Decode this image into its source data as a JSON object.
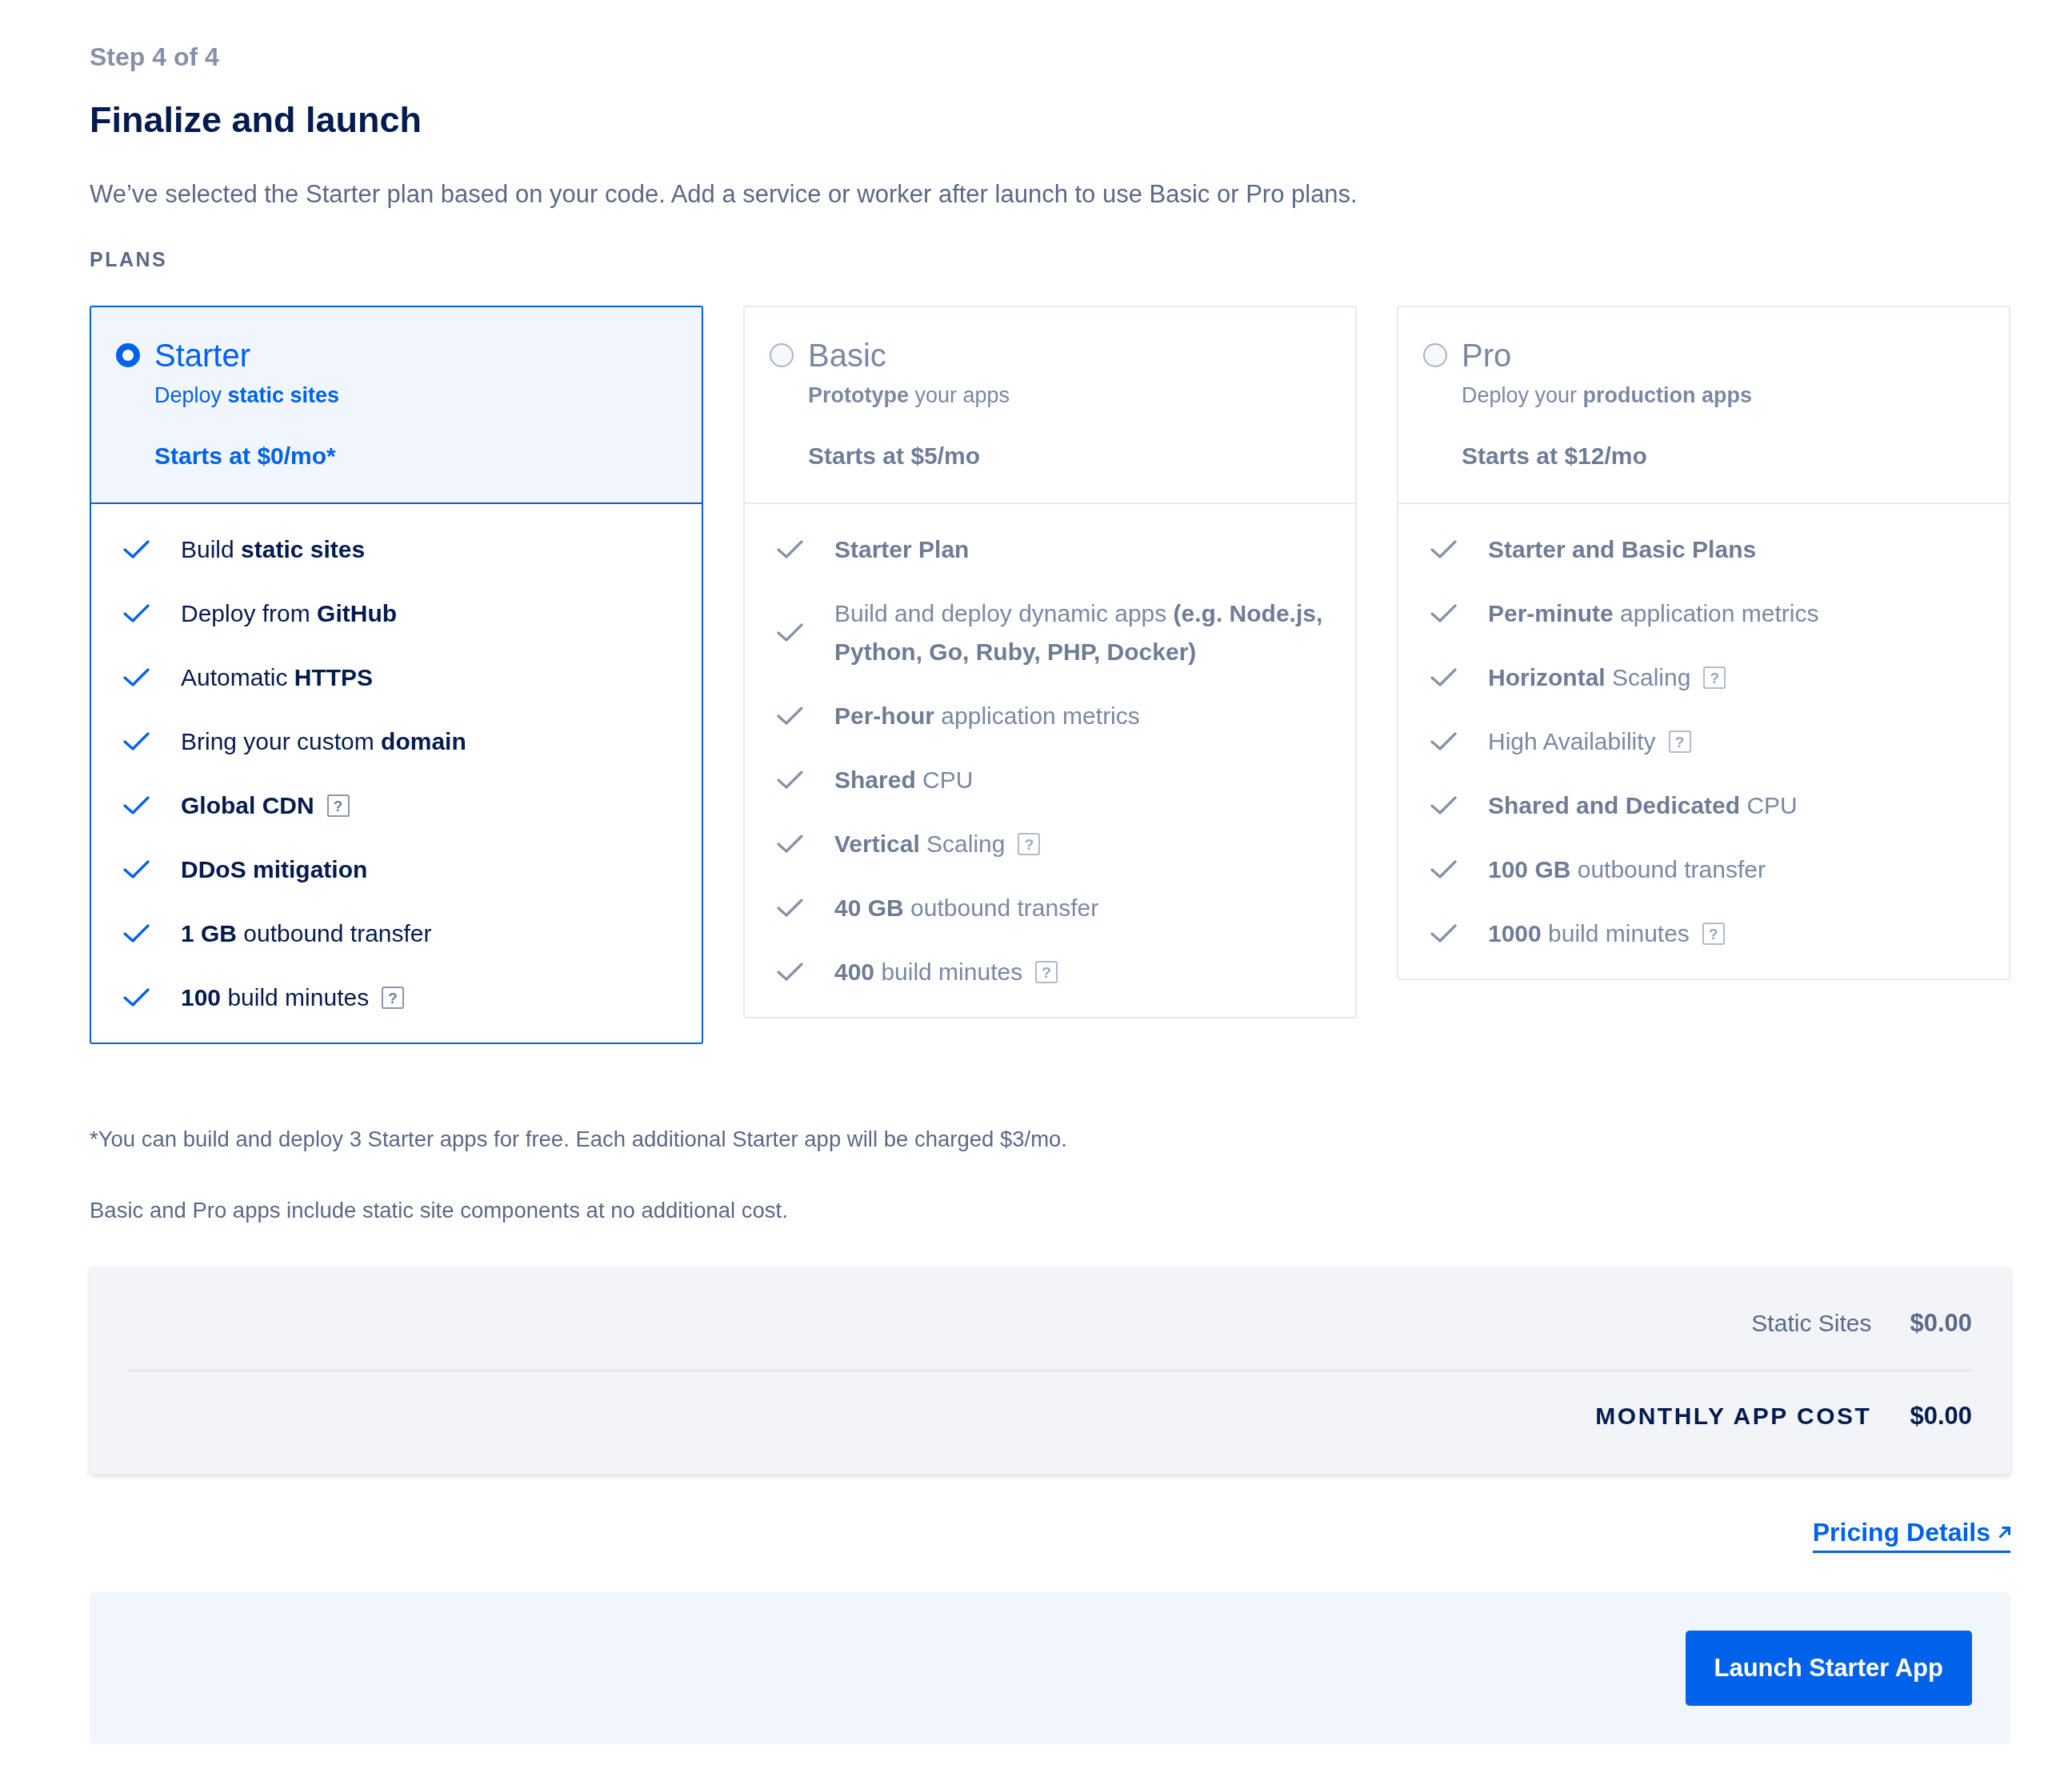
{
  "step": "Step 4 of 4",
  "title": "Finalize and launch",
  "description": "We’ve selected the Starter plan based on your code. Add a service or worker after launch to use Basic or Pro plans.",
  "plans_label": "PLANS",
  "plans": [
    {
      "name": "Starter",
      "selected": true,
      "tagline": "Deploy **static sites**",
      "price": "Starts at $0/mo*",
      "features": [
        {
          "text": "Build **static sites**"
        },
        {
          "text": "Deploy from **GitHub**"
        },
        {
          "text": "Automatic **HTTPS**"
        },
        {
          "text": "Bring your custom **domain**"
        },
        {
          "text": "Global CDN",
          "bold": true,
          "hint": "?"
        },
        {
          "text": "DDoS mitigation",
          "bold": true
        },
        {
          "text": "**1 GB** outbound transfer"
        },
        {
          "text": "**100** build minutes",
          "hint": "?"
        }
      ]
    },
    {
      "name": "Basic",
      "selected": false,
      "tagline": "**Prototype** your apps",
      "price": "Starts at $5/mo",
      "features": [
        {
          "text": "Starter Plan",
          "bold": true
        },
        {
          "text": "Build and deploy dynamic apps **(e.g. Node.js, Python, Go, Ruby, PHP, Docker)**"
        },
        {
          "text": "**Per-hour** application metrics"
        },
        {
          "text": "**Shared** CPU"
        },
        {
          "text": "**Vertical** Scaling",
          "hint": "?"
        },
        {
          "text": "**40 GB** outbound transfer"
        },
        {
          "text": "**400** build minutes",
          "hint": "?"
        }
      ]
    },
    {
      "name": "Pro",
      "selected": false,
      "tagline": "Deploy your **production apps**",
      "price": "Starts at $12/mo",
      "features": [
        {
          "text": "Starter and Basic Plans",
          "bold": true
        },
        {
          "text": "**Per-minute** application metrics"
        },
        {
          "text": "**Horizontal** Scaling",
          "hint": "?"
        },
        {
          "text": "High Availability",
          "hint": "?"
        },
        {
          "text": "**Shared and Dedicated** CPU"
        },
        {
          "text": "**100 GB** outbound transfer"
        },
        {
          "text": "**1000** build minutes",
          "hint": "?"
        }
      ]
    }
  ],
  "footnotes": [
    "*You can build and deploy 3 Starter apps for free. Each additional Starter app will be charged $3/mo.",
    "Basic and Pro apps include static site components at no additional cost."
  ],
  "summary": {
    "rows": [
      {
        "kind": "item",
        "label": "Static Sites",
        "amount": "$0.00"
      },
      {
        "kind": "total",
        "label": "MONTHLY APP COST",
        "amount": "$0.00"
      }
    ]
  },
  "pricing_link": "Pricing Details",
  "launch_button": "Launch Starter App"
}
